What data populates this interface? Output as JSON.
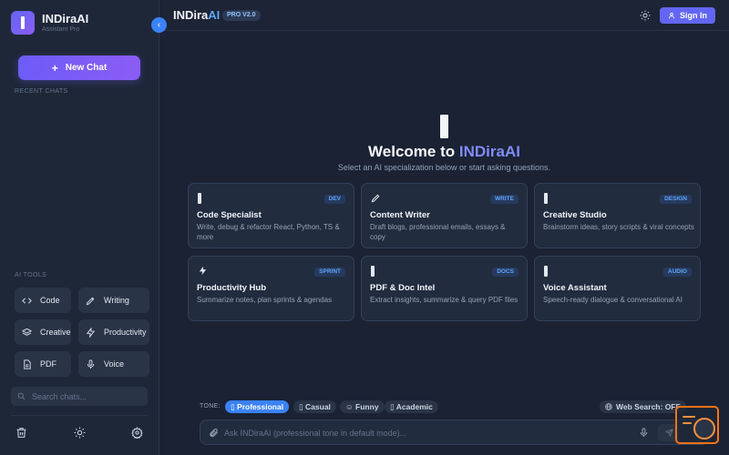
{
  "sidebar": {
    "brand_name": "INDiraAI",
    "brand_sub": "Assistant Pro",
    "new_chat_label": "New Chat",
    "recent_label": "RECENT CHATS",
    "tools_label": "AI TOOLS",
    "tools": [
      {
        "label": "Code",
        "icon": "code-icon"
      },
      {
        "label": "Writing",
        "icon": "pen-icon"
      },
      {
        "label": "Creative",
        "icon": "layers-icon"
      },
      {
        "label": "Productivity",
        "icon": "lightning-icon"
      },
      {
        "label": "PDF",
        "icon": "document-icon"
      },
      {
        "label": "Voice",
        "icon": "microphone-icon"
      }
    ],
    "search_placeholder": "Search chats..."
  },
  "header": {
    "title_main": "INDira",
    "title_accent": "AI",
    "badge": "PRO V2.0",
    "signin_label": "Sign In"
  },
  "welcome": {
    "title_prefix": "Welcome to ",
    "title_brand": "INDiraAI",
    "subtitle": "Select an AI specialization below or start asking questions."
  },
  "cards": [
    {
      "title": "Code Specialist",
      "badge": "DEV",
      "desc": "Write, debug & refactor React, Python, TS & more"
    },
    {
      "title": "Content Writer",
      "badge": "WRITE",
      "desc": "Draft blogs, professional emails, essays & copy"
    },
    {
      "title": "Creative Studio",
      "badge": "DESIGN",
      "desc": "Brainstorm ideas, story scripts & viral concepts"
    },
    {
      "title": "Productivity Hub",
      "badge": "SPRINT",
      "desc": "Summarize notes, plan sprints & agendas"
    },
    {
      "title": "PDF & Doc Intel",
      "badge": "DOCS",
      "desc": "Extract insights, summarize & query PDF files"
    },
    {
      "title": "Voice Assistant",
      "badge": "AUDIO",
      "desc": "Speech-ready dialogue & conversational AI"
    }
  ],
  "tone": {
    "label": "TONE:",
    "options": [
      {
        "label": "Professional",
        "active": true
      },
      {
        "label": "Casual",
        "active": false
      },
      {
        "label": "Funny",
        "active": false
      },
      {
        "label": "Academic",
        "active": false
      }
    ],
    "web_search": "Web Search: OFF"
  },
  "composer": {
    "placeholder": "Ask INDiraAI (professional tone in default mode)..."
  },
  "colors": {
    "accent": "#6366f1",
    "active_pill": "#3b82f6",
    "background": "#1a2234"
  }
}
